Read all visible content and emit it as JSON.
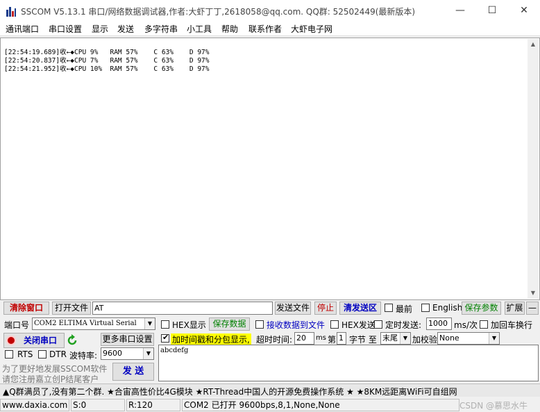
{
  "window": {
    "title": "SSCOM V5.13.1 串口/网络数据调试器,作者:大虾丁丁,2618058@qq.com. QQ群: 52502449(最新版本)",
    "minimize": "—",
    "maximize": "☐",
    "close": "✕"
  },
  "menu": [
    "通讯端口",
    "串口设置",
    "显示",
    "发送",
    "多字符串",
    "小工具",
    "帮助",
    "联系作者",
    "大虾电子网"
  ],
  "receive": {
    "lines": [
      "[22:54:19.689]收←◆CPU 9%   RAM 57%    C 63%    D 97%",
      "[22:54:20.837]收←◆CPU 7%   RAM 57%    C 63%    D 97%",
      "[22:54:21.952]收←◆CPU 10%  RAM 57%    C 63%    D 97%"
    ]
  },
  "toolbar1": {
    "clear_window": "清除窗口",
    "open_file": "打开文件",
    "file_path": "AT",
    "send_file": "发送文件",
    "stop": "停止",
    "clear_send": "清发送区",
    "topmost": "最前",
    "english": "English",
    "save_params": "保存参数",
    "expand": "扩展",
    "collapse": "—"
  },
  "toolbar2": {
    "port_label": "端口号",
    "port_value": "COM2 ELTIMA Virtual Serial",
    "hex_display": "HEX显示",
    "save_data": "保存数据",
    "recv_to_file": "接收数据到文件",
    "hex_send": "HEX发送",
    "timed_send": "定时发送:",
    "interval_value": "1000",
    "interval_unit": "ms/次",
    "add_crlf": "加回车换行"
  },
  "toolbar3": {
    "close_port": "关闭串口",
    "more_settings": "更多串口设置",
    "timestamp": "加时间戳和分包显示,",
    "timeout_label": "超时时间:",
    "timeout_value": "20",
    "timeout_unit": "ms",
    "byte_prefix": "第",
    "byte_value": "1",
    "byte_suffix": "字节 至",
    "end_value": "末尾",
    "checksum_label": "加校验",
    "checksum_value": "None"
  },
  "toolbar4": {
    "rts": "RTS",
    "dtr": "DTR",
    "baud_label": "波特率:",
    "baud_value": "9600"
  },
  "send": {
    "text": "abcdefg",
    "send_button": "发 送",
    "promo_line1": "为了更好地发展SSCOM软件",
    "promo_line2": "请您注册嘉立创P结尾客户"
  },
  "marquee": "▲Q群满员了,没有第二个群. ★合宙高性价比4G模块 ★RT-Thread中国人的开源免费操作系统 ★ ★8KM远距离WiFi可自组网",
  "statusbar": {
    "website": "www.daxia.com",
    "sent": "S:0",
    "received": "R:120",
    "port_status": "COM2 已打开  9600bps,8,1,None,None",
    "watermark": "CSDN @慕思水牛"
  },
  "colors": {
    "red_text": "#c00000",
    "green_text": "#008000",
    "blue_text": "#0000c0",
    "highlight": "#ffff00"
  }
}
